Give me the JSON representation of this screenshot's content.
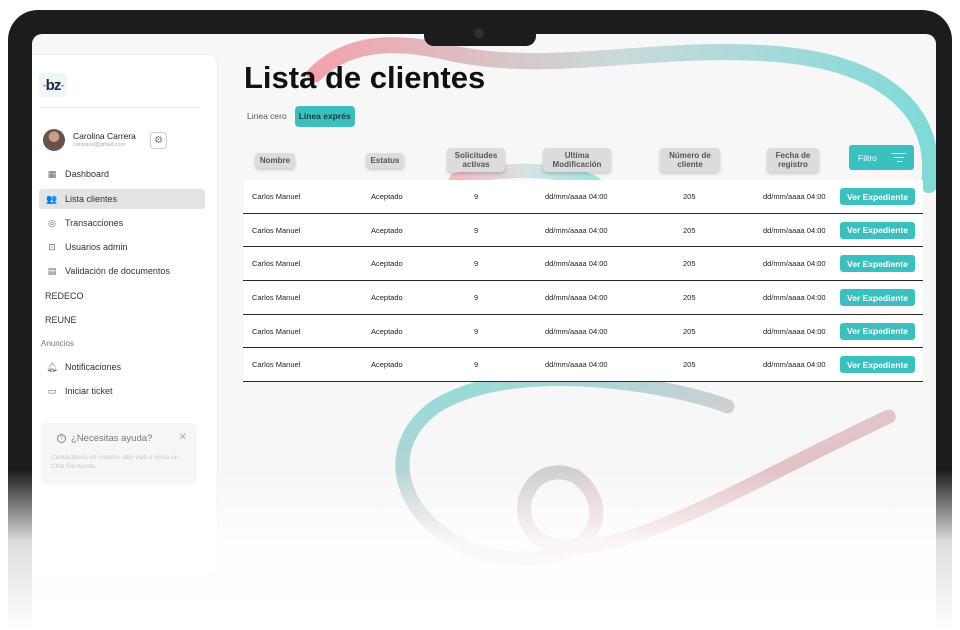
{
  "app": {
    "logo_text": "bz",
    "colors": {
      "accent": "#3cc0bf",
      "brand_pink": "#e97b86",
      "frame": "#1c1c1e"
    }
  },
  "sidebar": {
    "profile": {
      "name": "Carolina Carrera",
      "email": "carorace@gmail.com"
    },
    "items": [
      {
        "label": "Dashboard",
        "icon": "grid-icon",
        "active": false
      },
      {
        "label": "Lista clientes",
        "icon": "users-icon",
        "active": true
      },
      {
        "label": "Transacciones",
        "icon": "coins-icon",
        "active": false
      },
      {
        "label": "Usuarios admin",
        "icon": "admin-icon",
        "active": false
      },
      {
        "label": "Validación de documentos",
        "icon": "document-icon",
        "active": false
      },
      {
        "label": "REDECO"
      },
      {
        "label": "REUNE"
      }
    ],
    "section_label": "Anuncios",
    "announce_items": [
      {
        "label": "Notificaciones",
        "icon": "bell-icon"
      },
      {
        "label": "Iniciar ticket",
        "icon": "chat-icon"
      }
    ],
    "help": {
      "title": "¿Necesitas ayuda?",
      "body": "Contáctanos en nuestro sitio web o inicia un Chat De Ayuda."
    }
  },
  "main": {
    "title": "Lista de clientes",
    "tabs": [
      {
        "label": "Linea cero",
        "active": false
      },
      {
        "label": "Linea exprés",
        "active": true
      }
    ],
    "columns": [
      "Nombre",
      "Estatus",
      "Solicitudes activas",
      "Ultima Modificación",
      "Número de cliente",
      "Fecha de registro"
    ],
    "filter_label": "Filtro",
    "action_label": "Ver Expediente",
    "rows": [
      {
        "nombre": "Carlos Manuel",
        "estatus": "Aceptado",
        "solicitudes": "9",
        "modificacion": "dd/mm/aaaa 04:00",
        "numero": "205",
        "registro": "dd/mm/aaaa 04:00"
      },
      {
        "nombre": "Carlos Manuel",
        "estatus": "Aceptado",
        "solicitudes": "9",
        "modificacion": "dd/mm/aaaa 04:00",
        "numero": "205",
        "registro": "dd/mm/aaaa 04:00"
      },
      {
        "nombre": "Carlos Manuel",
        "estatus": "Aceptado",
        "solicitudes": "9",
        "modificacion": "dd/mm/aaaa 04:00",
        "numero": "205",
        "registro": "dd/mm/aaaa 04:00"
      },
      {
        "nombre": "Carlos Manuel",
        "estatus": "Aceptado",
        "solicitudes": "9",
        "modificacion": "dd/mm/aaaa 04:00",
        "numero": "205",
        "registro": "dd/mm/aaaa 04:00"
      },
      {
        "nombre": "Carlos Manuel",
        "estatus": "Aceptado",
        "solicitudes": "9",
        "modificacion": "dd/mm/aaaa 04:00",
        "numero": "205",
        "registro": "dd/mm/aaaa 04:00"
      },
      {
        "nombre": "Carlos Manuel",
        "estatus": "Aceptado",
        "solicitudes": "9",
        "modificacion": "dd/mm/aaaa 04:00",
        "numero": "205",
        "registro": "dd/mm/aaaa 04:00"
      }
    ]
  }
}
